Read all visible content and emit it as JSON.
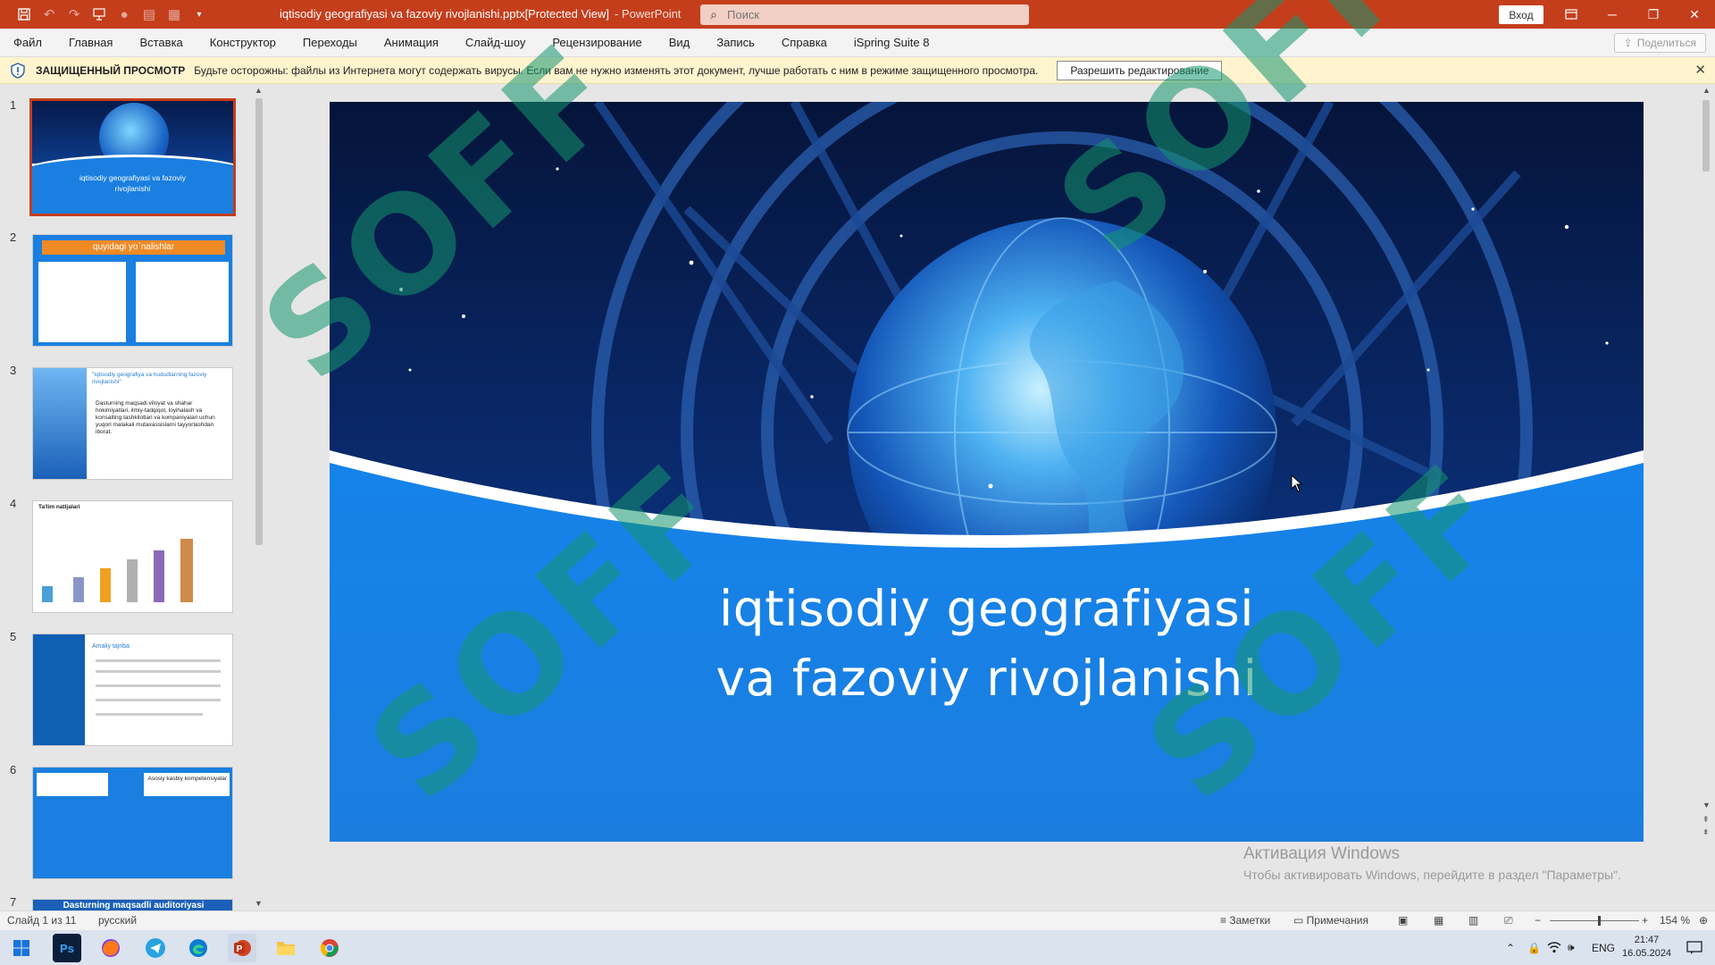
{
  "window": {
    "title": "iqtisodiy geografiyasi va fazoviy rivojlanishi.pptx[Protected View]",
    "app_suffix": "-  PowerPoint",
    "search_placeholder": "Поиск",
    "signin_label": "Вход"
  },
  "ribbon": {
    "tabs": [
      "Файл",
      "Главная",
      "Вставка",
      "Конструктор",
      "Переходы",
      "Анимация",
      "Слайд-шоу",
      "Рецензирование",
      "Вид",
      "Запись",
      "Справка",
      "iSpring Suite 8"
    ],
    "share_label": "Поделиться"
  },
  "message_bar": {
    "title": "ЗАЩИЩЕННЫЙ ПРОСМОТР",
    "text": "Будьте осторожны: файлы из Интернета могут содержать вирусы. Если вам не нужно изменять этот документ, лучше работать с ним в режиме защищенного просмотра.",
    "enable_label": "Разрешить редактирование"
  },
  "thumbnails": [
    {
      "num": "1",
      "title": "iqtisodiy geografiyasi va fazoviy rivojlanishi"
    },
    {
      "num": "2",
      "title": "quyidagi yo`nalishlar"
    },
    {
      "num": "3",
      "title": "\"Iqtisodiy geografiya va hududlarning fazoviy rivojlanishi\"",
      "body": "Dasturning maqsadi viloyat va shahar hokimiyatlari, ilmiy-tadqiqot, loyihalash va konsalting tashkilotlari va kompaniyalari uchun yuqori malakali mutaxassislarni tayyorlashdan iborat."
    },
    {
      "num": "4",
      "title": "Ta'lim natijalari"
    },
    {
      "num": "5",
      "title": "Amaliy tajriba"
    },
    {
      "num": "6",
      "title": "Asosiy kasbiy kompetensiyalar"
    },
    {
      "num": "7",
      "title": "Dasturning maqsadli auditoriyasi"
    }
  ],
  "slide": {
    "title_line1": "iqtisodiy geografiyasi",
    "title_line2": "va fazoviy rivojlanishi"
  },
  "activation": {
    "line1": "Активация Windows",
    "line2": "Чтобы активировать Windows, перейдите в раздел \"Параметры\"."
  },
  "watermark": "SOFF",
  "status": {
    "slide_counter": "Слайд 1 из 11",
    "language": "русский",
    "notes_label": "Заметки",
    "comments_label": "Примечания",
    "zoom": "154 %"
  },
  "taskbar": {
    "lang": "ENG",
    "time": "21:47",
    "date": "16.05.2024"
  },
  "colors": {
    "accent": "#c43e1c",
    "slide_blue": "#1a7fe0",
    "message_bar": "#fff4ce"
  }
}
